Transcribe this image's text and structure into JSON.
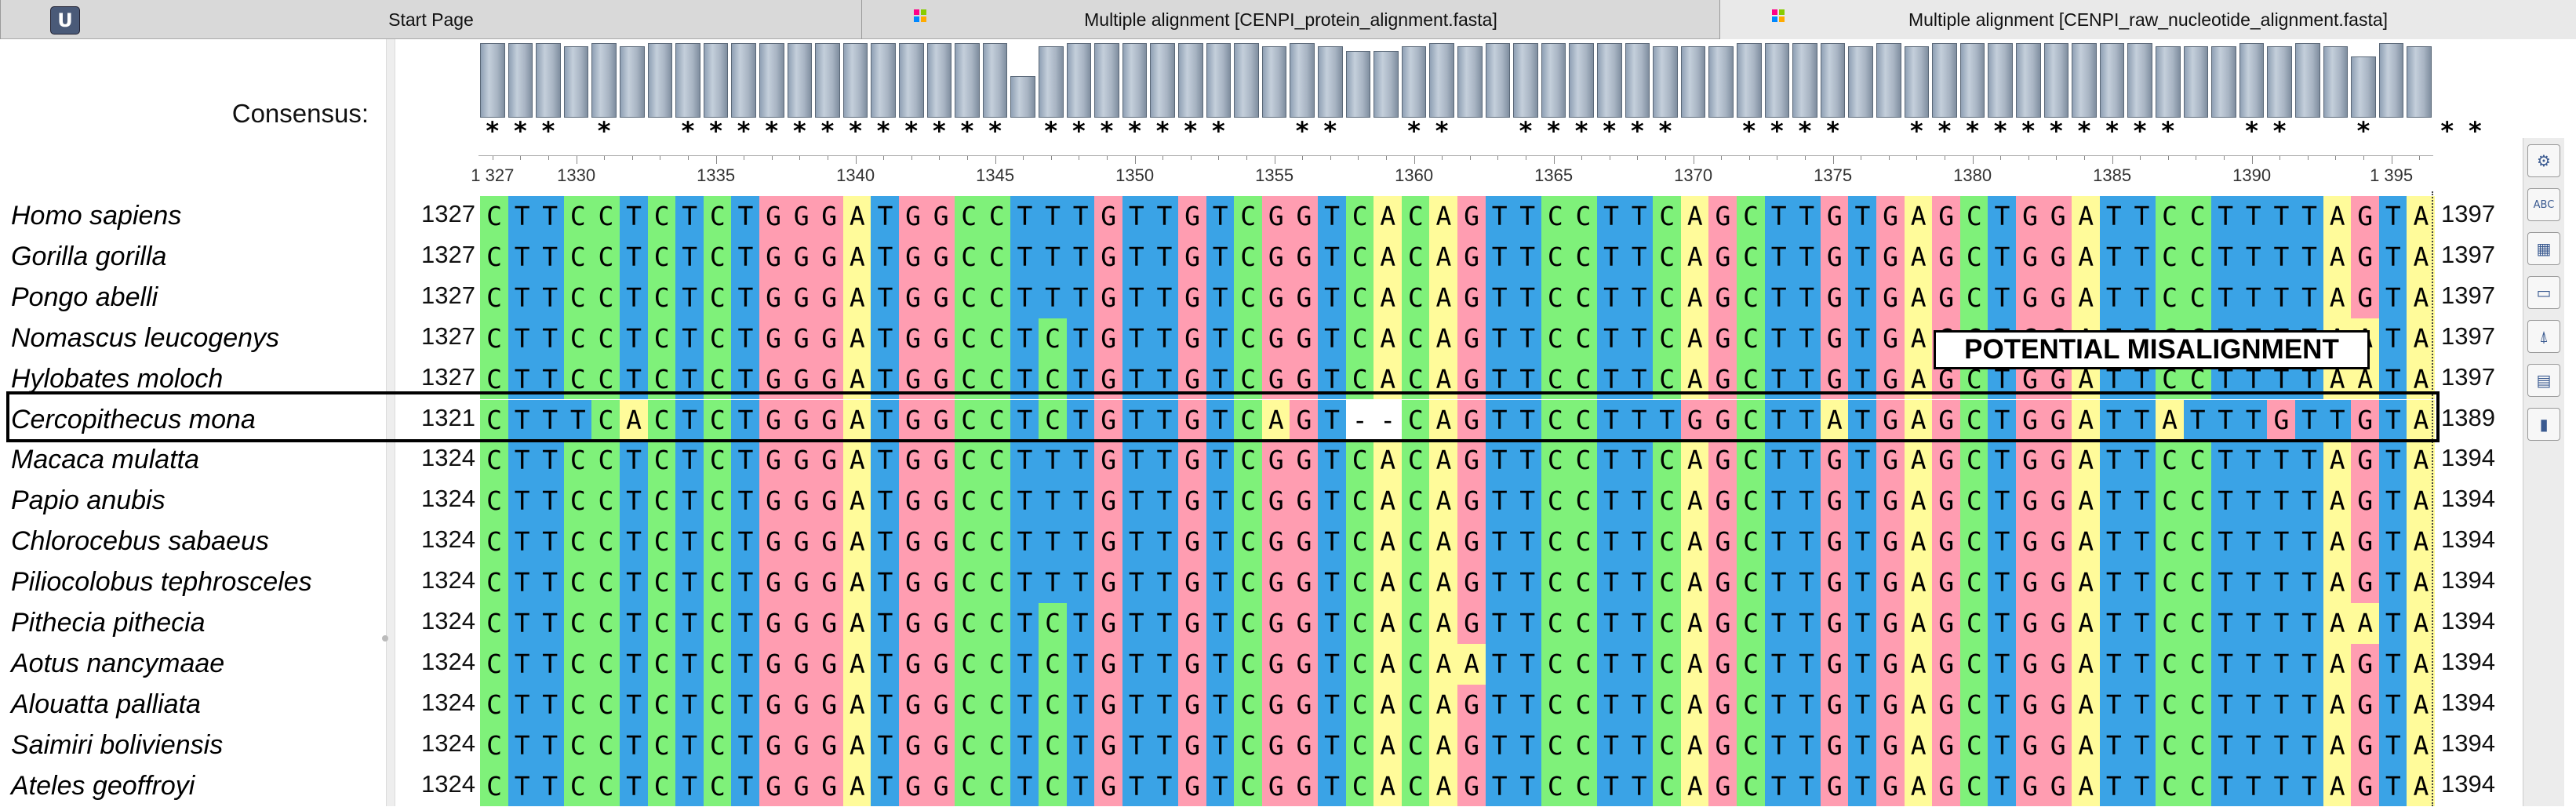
{
  "tabs": [
    {
      "label": "Start Page",
      "active": false
    },
    {
      "label": "Multiple alignment [CENPI_protein_alignment.fasta]",
      "active": false
    },
    {
      "label": "Multiple alignment [CENPI_raw_nucleotide_alignment.fasta]",
      "active": true
    }
  ],
  "app_logo": "U",
  "consensus": {
    "label": "Consensus:",
    "heights": [
      0.97,
      0.97,
      0.97,
      0.93,
      0.97,
      0.93,
      0.97,
      0.97,
      0.97,
      0.97,
      0.97,
      0.97,
      0.97,
      0.97,
      0.97,
      0.97,
      0.97,
      0.97,
      0.97,
      0.54,
      0.93,
      0.97,
      0.97,
      0.97,
      0.97,
      0.97,
      0.97,
      0.97,
      0.93,
      0.97,
      0.93,
      0.87,
      0.87,
      0.93,
      0.97,
      0.93,
      0.97,
      0.97,
      0.97,
      0.97,
      0.97,
      0.97,
      0.93,
      0.93,
      0.93,
      0.97,
      0.97,
      0.97,
      0.97,
      0.93,
      0.97,
      0.93,
      0.97,
      0.97,
      0.97,
      0.97,
      0.97,
      0.97,
      0.97,
      0.97,
      0.93,
      0.93,
      0.93,
      0.97,
      0.93,
      0.97,
      0.93,
      0.8,
      0.97,
      0.93
    ],
    "stars": "*** *  ************ *******  **  **  ******  ****  **********  **  *  **"
  },
  "ruler": {
    "start": 1327,
    "labels": [
      {
        "pos": 1327,
        "text": "1 327"
      },
      {
        "pos": 1330,
        "text": "1330"
      },
      {
        "pos": 1335,
        "text": "1335"
      },
      {
        "pos": 1340,
        "text": "1340"
      },
      {
        "pos": 1345,
        "text": "1345"
      },
      {
        "pos": 1350,
        "text": "1350"
      },
      {
        "pos": 1355,
        "text": "1355"
      },
      {
        "pos": 1360,
        "text": "1360"
      },
      {
        "pos": 1365,
        "text": "1365"
      },
      {
        "pos": 1370,
        "text": "1370"
      },
      {
        "pos": 1375,
        "text": "1375"
      },
      {
        "pos": 1380,
        "text": "1380"
      },
      {
        "pos": 1385,
        "text": "1385"
      },
      {
        "pos": 1390,
        "text": "1390"
      },
      {
        "pos": 1395,
        "text": "1 395"
      }
    ]
  },
  "colors": {
    "A": "#fffb9a",
    "C": "#7ff17a",
    "G": "#ff9db1",
    "T": "#3aa3e6",
    "-": "#ffffff"
  },
  "sequences": [
    {
      "species": "Homo sapiens",
      "start": "1327",
      "end": "1397",
      "seq": "CTTCCTCTCTGGGATGGCCTTTGTTGTCGGTCACAGTTCCTTCAGCTTGTGAGCTGGATTCCTTTTAGTA"
    },
    {
      "species": "Gorilla gorilla",
      "start": "1327",
      "end": "1397",
      "seq": "CTTCCTCTCTGGGATGGCCTTTGTTGTCGGTCACAGTTCCTTCAGCTTGTGAGCTGGATTCCTTTTAGTA"
    },
    {
      "species": "Pongo abelli",
      "start": "1327",
      "end": "1397",
      "seq": "CTTCCTCTCTGGGATGGCCTTTGTTGTCGGTCACAGTTCCTTCAGCTTGTGAGCTGGATTCCTTTTAGTA"
    },
    {
      "species": "Nomascus leucogenys",
      "start": "1327",
      "end": "1397",
      "seq": "CTTCCTCTCTGGGATGGCCTCTGTTGTCGGTCACAGTTCCTTCAGCTTGTGAGCTGGATTCCTTTTAATA"
    },
    {
      "species": "Hylobates moloch",
      "start": "1327",
      "end": "1397",
      "seq": "CTTCCTCTCTGGGATGGCCTCTGTTGTCGGTCACAGTTCCTTCAGCTTGTGAGCTGGATTCCTTTTAATA"
    },
    {
      "species": "Cercopithecus mona",
      "start": "1321",
      "end": "1389",
      "seq": "CTTTCACTCTGGGATGGCCTCTGTTGTCAGT--CAGTTCCTTTGGCTTATGAGCTGGATTATTTGTTGTA"
    },
    {
      "species": "Macaca mulatta",
      "start": "1324",
      "end": "1394",
      "seq": "CTTCCTCTCTGGGATGGCCTTTGTTGTCGGTCACAGTTCCTTCAGCTTGTGAGCTGGATTCCTTTTAGTA"
    },
    {
      "species": "Papio anubis",
      "start": "1324",
      "end": "1394",
      "seq": "CTTCCTCTCTGGGATGGCCTTTGTTGTCGGTCACAGTTCCTTCAGCTTGTGAGCTGGATTCCTTTTAGTA"
    },
    {
      "species": "Chlorocebus sabaeus",
      "start": "1324",
      "end": "1394",
      "seq": "CTTCCTCTCTGGGATGGCCTTTGTTGTCGGTCACAGTTCCTTCAGCTTGTGAGCTGGATTCCTTTTAGTA"
    },
    {
      "species": "Piliocolobus tephrosceles",
      "start": "1324",
      "end": "1394",
      "seq": "CTTCCTCTCTGGGATGGCCTTTGTTGTCGGTCACAGTTCCTTCAGCTTGTGAGCTGGATTCCTTTTAGTA"
    },
    {
      "species": "Pithecia pithecia",
      "start": "1324",
      "end": "1394",
      "seq": "CTTCCTCTCTGGGATGGCCTCTGTTGTCGGTCACAGTTCCTTCAGCTTGTGAGCTGGATTCCTTTTAATA"
    },
    {
      "species": "Aotus nancymaae",
      "start": "1324",
      "end": "1394",
      "seq": "CTTCCTCTCTGGGATGGCCTCTGTTGTCGGTCACAATTCCTTCAGCTTGTGAGCTGGATTCCTTTTAGTA"
    },
    {
      "species": "Alouatta palliata",
      "start": "1324",
      "end": "1394",
      "seq": "CTTCCTCTCTGGGATGGCCTCTGTTGTCGGTCACAGTTCCTTCAGCTTGTGAGCTGGATTCCTTTTAGTA"
    },
    {
      "species": "Saimiri boliviensis",
      "start": "1324",
      "end": "1394",
      "seq": "CTTCCTCTCTGGGATGGCCTCTGTTGTCGGTCACAGTTCCTTCAGCTTGTGAGCTGGATTCCTTTTAGTA"
    },
    {
      "species": "Ateles geoffroyi",
      "start": "1324",
      "end": "1394",
      "seq": "CTTCCTCTCTGGGATGGCCTCTGTTGTCGGTCACAGTTCCTTCAGCTTGTGAGCTGGATTCCTTTTAGTA"
    }
  ],
  "highlight": {
    "species": "Cercopithecus mona"
  },
  "annotation": "POTENTIAL MISALIGNMENT",
  "toolbar": [
    {
      "icon": "gear-icon",
      "glyph": "⚙"
    },
    {
      "icon": "abc-icon",
      "glyph": "ABC"
    },
    {
      "icon": "color-scheme-icon",
      "glyph": "▦"
    },
    {
      "icon": "layout-icon",
      "glyph": "▭"
    },
    {
      "icon": "tree-icon",
      "glyph": "⍋"
    },
    {
      "icon": "stats-icon",
      "glyph": "▤"
    },
    {
      "icon": "chart-icon",
      "glyph": "▮"
    }
  ]
}
